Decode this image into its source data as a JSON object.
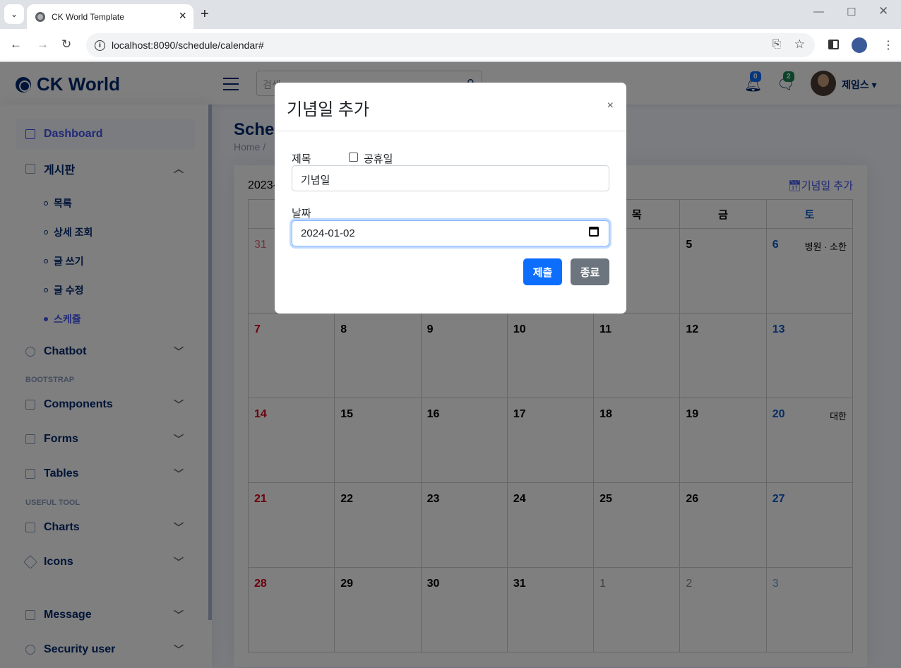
{
  "browser": {
    "tab_title": "CK World Template",
    "url": "localhost:8090/schedule/calendar#"
  },
  "app": {
    "logo_text": "CK World",
    "search_placeholder": "검색",
    "notifications_count": "0",
    "messages_count": "2",
    "user_name": "제임스"
  },
  "sidebar": {
    "dashboard": "Dashboard",
    "board": "게시판",
    "board_items": [
      "목록",
      "상세 조회",
      "글 쓰기",
      "글 수정",
      "스케쥴"
    ],
    "chatbot": "Chatbot",
    "section_bootstrap": "BOOTSTRAP",
    "components": "Components",
    "forms": "Forms",
    "tables": "Tables",
    "section_useful": "USEFUL TOOL",
    "charts": "Charts",
    "icons": "Icons",
    "message": "Message",
    "security_user": "Security user"
  },
  "page": {
    "title": "Sched",
    "breadcrumb": "Home  /",
    "month_label": "2023-",
    "add_anniversary": "기념일 추가"
  },
  "calendar": {
    "weekdays": [
      "",
      "",
      "",
      "",
      "목",
      "금",
      "토"
    ],
    "weeks": [
      [
        {
          "d": "31",
          "t": "sun-other"
        },
        {
          "d": ""
        },
        {
          "d": ""
        },
        {
          "d": ""
        },
        {
          "d": ""
        },
        {
          "d": "5"
        },
        {
          "d": "6",
          "t": "sat",
          "ev": "병원 · 소한"
        }
      ],
      [
        {
          "d": "7",
          "t": "sun"
        },
        {
          "d": "8"
        },
        {
          "d": "9"
        },
        {
          "d": "10"
        },
        {
          "d": "11"
        },
        {
          "d": "12"
        },
        {
          "d": "13",
          "t": "sat"
        }
      ],
      [
        {
          "d": "14",
          "t": "sun"
        },
        {
          "d": "15"
        },
        {
          "d": "16"
        },
        {
          "d": "17"
        },
        {
          "d": "18"
        },
        {
          "d": "19"
        },
        {
          "d": "20",
          "t": "sat",
          "ev": "대한"
        }
      ],
      [
        {
          "d": "21",
          "t": "sun"
        },
        {
          "d": "22"
        },
        {
          "d": "23"
        },
        {
          "d": "24"
        },
        {
          "d": "25"
        },
        {
          "d": "26"
        },
        {
          "d": "27",
          "t": "sat"
        }
      ],
      [
        {
          "d": "28",
          "t": "sun"
        },
        {
          "d": "29"
        },
        {
          "d": "30"
        },
        {
          "d": "31"
        },
        {
          "d": "1",
          "t": "other"
        },
        {
          "d": "2",
          "t": "other"
        },
        {
          "d": "3",
          "t": "sat-other"
        }
      ]
    ]
  },
  "modal": {
    "title": "기념일 추가",
    "close": "×",
    "subject_label": "제목",
    "holiday_label": "공휴일",
    "subject_value": "기념일",
    "date_label": "날짜",
    "date_value": "2024-01-02",
    "submit": "제출",
    "cancel": "종료"
  },
  "colors": {
    "primary": "#0d6efd",
    "secondary": "#6c757d",
    "brand": "#012970",
    "accent": "#4154f1",
    "sunday": "#d9001b",
    "saturday": "#0a58ca"
  }
}
